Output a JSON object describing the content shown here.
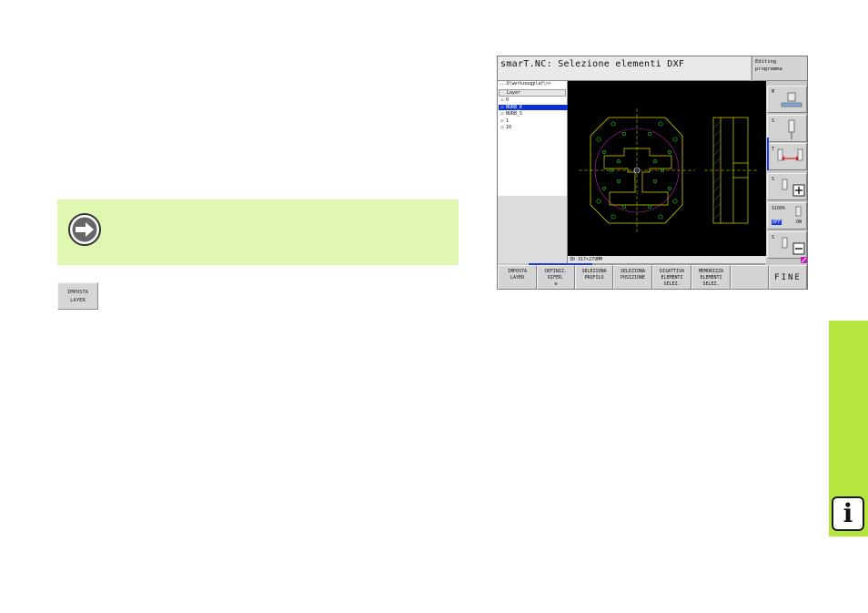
{
  "screen": {
    "title": "smarT.NC: Selezione elementi DXF",
    "mode_label_1": "Editing",
    "mode_label_2": "programma",
    "path": "...O\\werkzeugplat\\>>",
    "layer_header": "Layer",
    "layers": [
      {
        "check": "☑",
        "name": "0",
        "selected": false
      },
      {
        "check": "☑",
        "name": "NURB_K",
        "selected": true
      },
      {
        "check": "☑",
        "name": "NURB_S",
        "selected": false
      },
      {
        "check": "☑",
        "name": "1",
        "selected": false
      },
      {
        "check": "☑",
        "name": "10",
        "selected": false
      }
    ],
    "status": "3D  317×279MM",
    "right_keys": [
      {
        "label": "M"
      },
      {
        "label": "S"
      },
      {
        "label": "T"
      },
      {
        "label": "S"
      },
      {
        "label": "S100%",
        "off": "OFF",
        "on": "ON"
      },
      {
        "label": "S"
      }
    ],
    "softkeys": [
      {
        "line1": "IMPOSTA",
        "line2": "LAYER",
        "line3": ""
      },
      {
        "line1": "DEFINIZ.",
        "line2": "RIFER.",
        "line3": "⊕"
      },
      {
        "line1": "SELEZIONA",
        "line2": "PROFILO",
        "line3": ""
      },
      {
        "line1": "SELEZIONA",
        "line2": "POSIZIONE",
        "line3": ""
      },
      {
        "line1": "DISATTIVA",
        "line2": "ELEMENTI",
        "line3": "SELEZ."
      },
      {
        "line1": "MEMORIZZA",
        "line2": "ELEMENTI",
        "line3": "SELEZ."
      },
      {
        "line1": "",
        "line2": "",
        "line3": ""
      },
      {
        "line1": "FINE",
        "line2": "",
        "line3": ""
      }
    ]
  },
  "page": {
    "icon_softkey_line1": "IMPOSTA",
    "icon_softkey_line2": "LAYER",
    "side_tab_letter": "i"
  },
  "colors": {
    "note_bg": "#dff7b0",
    "side_tab": "#b5e63b",
    "canvas_bg": "#000000",
    "selection_blue": "#0a2fd6",
    "drawing_yellow": "#d8d800",
    "drawing_green": "#20c020",
    "drawing_magenta": "#c020c0"
  }
}
